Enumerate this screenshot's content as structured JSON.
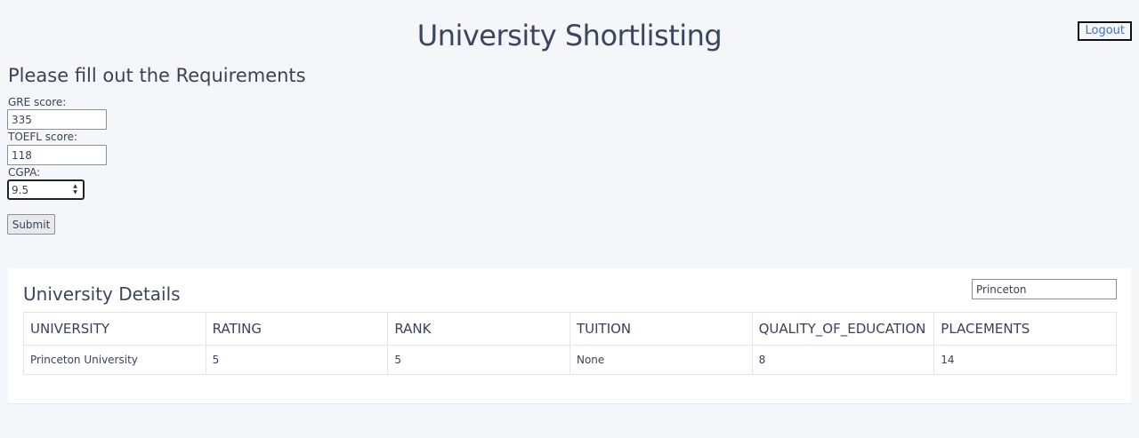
{
  "header": {
    "title": "University Shortlisting",
    "logout_label": "Logout"
  },
  "form": {
    "heading": "Please fill out the Requirements",
    "gre_label": "GRE score:",
    "gre_value": "335",
    "toefl_label": "TOEFL score:",
    "toefl_value": "118",
    "cgpa_label": "CGPA:",
    "cgpa_value": "9.5",
    "submit_label": "Submit"
  },
  "details": {
    "title": "University Details",
    "search_value": "Princeton",
    "columns": [
      "UNIVERSITY",
      "RATING",
      "RANK",
      "TUITION",
      "QUALITY_OF_EDUCATION",
      "PLACEMENTS"
    ],
    "rows": [
      [
        "Princeton University",
        "5",
        "5",
        "None",
        "8",
        "14"
      ]
    ]
  },
  "icons": {
    "spin_up": "spinner-up-icon",
    "spin_down": "spinner-down-icon"
  }
}
